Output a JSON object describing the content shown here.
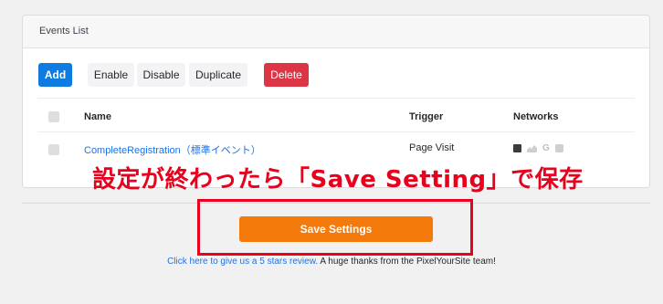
{
  "events_card": {
    "title": "Events List",
    "toolbar": {
      "add": "Add",
      "enable": "Enable",
      "disable": "Disable",
      "duplicate": "Duplicate",
      "delete": "Delete"
    },
    "columns": {
      "name": "Name",
      "trigger": "Trigger",
      "networks": "Networks"
    },
    "rows": [
      {
        "name": "CompleteRegistration（標準イベント）",
        "trigger": "Page Visit",
        "networks": [
          "facebook-icon",
          "analytics-icon",
          "google-icon",
          "pinterest-icon"
        ]
      }
    ]
  },
  "annotation": "設定が終わったら「Save Setting」で保存",
  "save": {
    "label": "Save Settings"
  },
  "footer": {
    "link_text": "Click here to give us a 5 stars review.",
    "text": " A huge thanks from the PixelYourSite team!"
  },
  "colors": {
    "primary": "#0d7be0",
    "danger": "#dc3545",
    "save": "#f47a0b",
    "annotation": "#e8001c"
  }
}
